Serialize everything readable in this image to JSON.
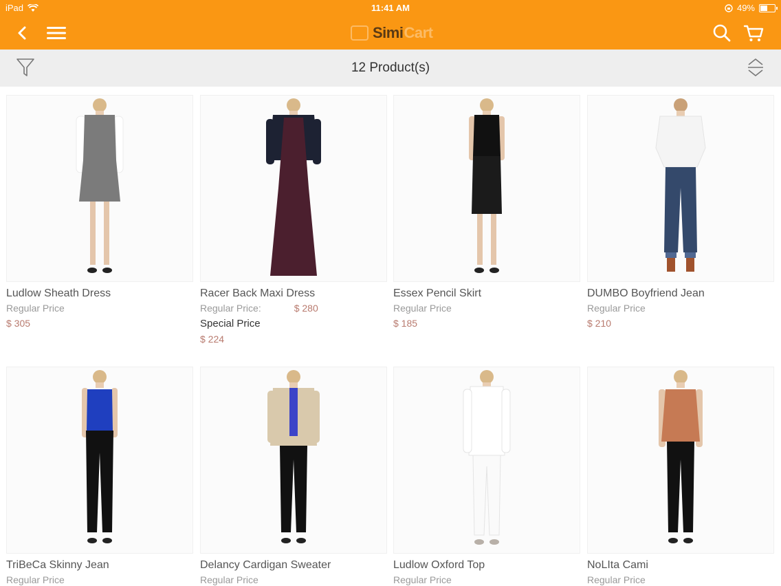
{
  "status_bar": {
    "device": "iPad",
    "time": "11:41 AM",
    "battery": "49%",
    "battery_level": 0.49
  },
  "header": {
    "logo_text_a": "Simi",
    "logo_text_b": "Cart",
    "colors": {
      "bar": "#fa9713"
    }
  },
  "icons": {
    "back": "chevron-left-icon",
    "menu": "hamburger-menu-icon",
    "search": "search-icon",
    "cart": "shopping-cart-icon",
    "filter": "filter-icon",
    "sort": "sort-icon"
  },
  "toolbar": {
    "product_count": "12 Product(s)"
  },
  "products": [
    {
      "name": "Ludlow Sheath Dress",
      "regular_label": "Regular Price",
      "price": "$ 305"
    },
    {
      "name": "Racer Back Maxi Dress",
      "regular_label": "Regular Price:",
      "regular_price": "$ 280",
      "special_label": "Special Price",
      "special_price": "$ 224"
    },
    {
      "name": "Essex Pencil Skirt",
      "regular_label": "Regular Price",
      "price": "$ 185"
    },
    {
      "name": "DUMBO Boyfriend Jean",
      "regular_label": "Regular Price",
      "price": "$ 210"
    },
    {
      "name": "TriBeCa Skinny Jean",
      "regular_label": "Regular Price"
    },
    {
      "name": "Delancy Cardigan Sweater",
      "regular_label": "Regular Price"
    },
    {
      "name": "Ludlow Oxford Top",
      "regular_label": "Regular Price"
    },
    {
      "name": "NoLIta Cami",
      "regular_label": "Regular Price"
    }
  ]
}
